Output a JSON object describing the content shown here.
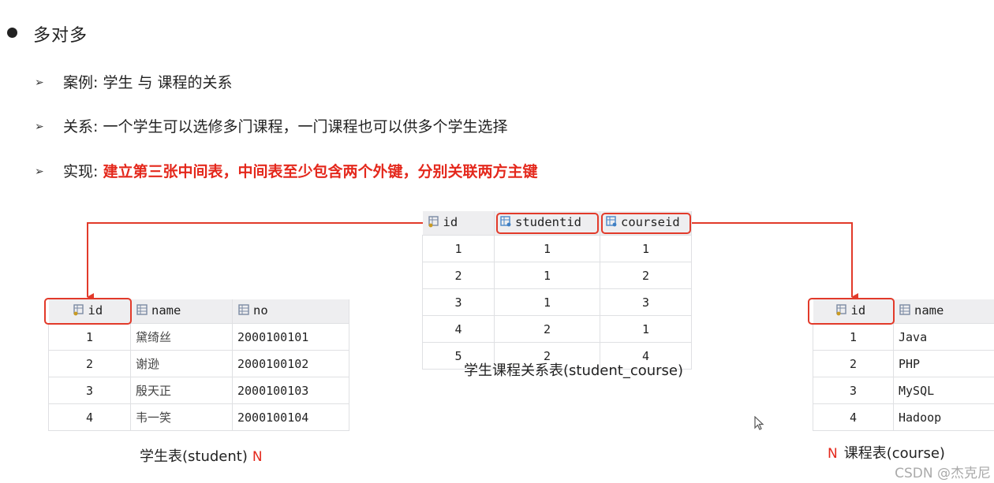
{
  "heading": "多对多",
  "bullets": [
    {
      "label": "案例: ",
      "text": "学生 与 课程的关系"
    },
    {
      "label": "关系: ",
      "text": "一个学生可以选修多门课程，一门课程也可以供多个学生选择"
    },
    {
      "label": "实现: ",
      "text": "建立第三张中间表，中间表至少包含两个外键，分别关联两方主键"
    }
  ],
  "student_table": {
    "headers": [
      "id",
      "name",
      "no"
    ],
    "rows": [
      [
        "1",
        "黛绮丝",
        "2000100101"
      ],
      [
        "2",
        "谢逊",
        "2000100102"
      ],
      [
        "3",
        "殷天正",
        "2000100103"
      ],
      [
        "4",
        "韦一笑",
        "2000100104"
      ]
    ],
    "caption": "学生表(student)",
    "cardinality": "N"
  },
  "relation_table": {
    "headers": [
      "id",
      "studentid",
      "courseid"
    ],
    "rows": [
      [
        "1",
        "1",
        "1"
      ],
      [
        "2",
        "1",
        "2"
      ],
      [
        "3",
        "1",
        "3"
      ],
      [
        "4",
        "2",
        "1"
      ],
      [
        "5",
        "2",
        "4"
      ]
    ],
    "caption": "学生课程关系表(student_course)"
  },
  "course_table": {
    "headers": [
      "id",
      "name"
    ],
    "rows": [
      [
        "1",
        "Java"
      ],
      [
        "2",
        "PHP"
      ],
      [
        "3",
        "MySQL"
      ],
      [
        "4",
        "Hadoop"
      ]
    ],
    "caption": "课程表(course)",
    "cardinality": "N"
  },
  "colors": {
    "accent_red": "#e4281c",
    "header_bg": "#eeeef0"
  },
  "watermark": "CSDN @杰克尼"
}
